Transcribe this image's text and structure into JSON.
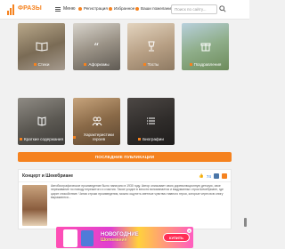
{
  "header": {
    "logo_text": "ФРАЗЫ",
    "menu_label": "Меню",
    "register_label": "Регистрация",
    "favorites_label": "Избранное",
    "suggest_label": "Ваши пожелания",
    "search_placeholder": "Поиск по сайту..."
  },
  "categories": [
    {
      "label": "Стихи",
      "icon": "book-open-icon"
    },
    {
      "label": "Афоризмы",
      "icon": "quote-icon"
    },
    {
      "label": "Тосты",
      "icon": "glass-icon"
    },
    {
      "label": "Поздравления",
      "icon": "gift-icon"
    },
    {
      "label": "Краткие содержания",
      "icon": "book-icon"
    },
    {
      "label": "Характеристики героев",
      "icon": "people-icon"
    },
    {
      "label": "Биографии",
      "icon": "list-icon"
    }
  ],
  "latest_button": "ПОСЛЕДНИЕ ПУБЛИКАЦИИ",
  "post": {
    "title": "Концерт и Шекебриане",
    "likes": "74",
    "text": "Автобиографическое произведение было написано в 1930 году. Автор описывает свою дореволюционную детскую, свое переживание по поводу пережитого и счастия. Такое уходит в юности вспоминается и выдуманных строк Шекебриане, где царит спокойствие. Читая строки произведения, можно ощутить светлые чувства главного героя, которые через всю книгу выражаются..."
  },
  "ad": {
    "headline": "НОВОГОДНИЕ",
    "subline": "Шопомания",
    "buy_label": "КУПИТЬ",
    "close": "×"
  }
}
